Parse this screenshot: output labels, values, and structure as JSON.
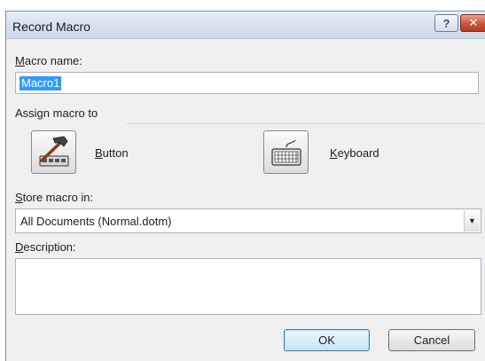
{
  "dialog": {
    "title": "Record Macro",
    "help_button": "?",
    "close_button": "✕"
  },
  "macro_name": {
    "label_first": "M",
    "label_rest": "acro name:",
    "value": "Macro1"
  },
  "assign": {
    "label": "Assign macro to",
    "button": {
      "label_first": "B",
      "label_rest": "utton",
      "icon": "hammer-icon"
    },
    "keyboard": {
      "label_first": "K",
      "label_rest": "eyboard",
      "icon": "keyboard-icon"
    }
  },
  "store": {
    "label_first": "S",
    "label_rest": "tore macro in:",
    "selected": "All Documents (Normal.dotm)"
  },
  "description": {
    "label_first": "D",
    "label_rest": "escription:",
    "value": ""
  },
  "footer": {
    "ok_label": "OK",
    "cancel_label": "Cancel"
  }
}
